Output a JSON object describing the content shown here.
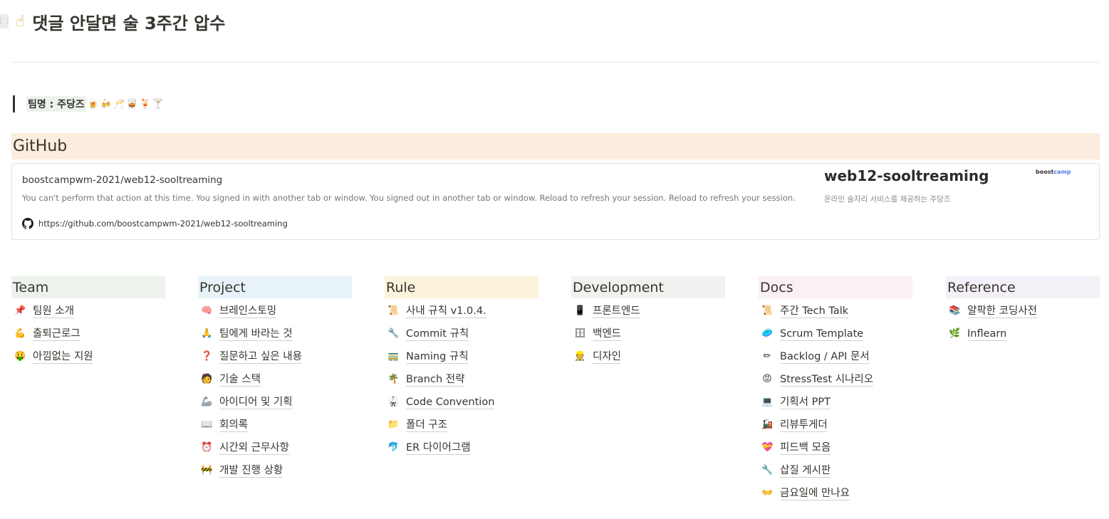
{
  "page": {
    "title_emoji": "☝",
    "title": "댓글 안달면 술 3주간 압수"
  },
  "quote": {
    "text": "팀명 : 주당즈",
    "emojis": "🍺🍻🥂🥃🍹🍸"
  },
  "github_section": {
    "heading": "GitHub",
    "bookmark": {
      "title": "boostcampwm-2021/web12-sooltreaming",
      "description": "You can't perform that action at this time. You signed in with another tab or window. You signed out in another tab or window. Reload to refresh your session. Reload to refresh your session.",
      "url": "https://github.com/boostcampwm-2021/web12-sooltreaming",
      "preview_title": "web12-sooltreaming",
      "preview_subtitle": "온라인 술자리 서비스를 제공하는 주당즈",
      "preview_logo_a": "boost",
      "preview_logo_b": "camp"
    }
  },
  "colors": {
    "team": "#edf3ec",
    "project": "#e7f3f8",
    "rule": "#fbf3db",
    "development": "#f1f1ef",
    "docs": "#fbf0f4",
    "reference": "#f4f0f7",
    "github_heading": "#fbecdd"
  },
  "columns": [
    {
      "header": "Team",
      "items": [
        {
          "icon": "📌",
          "icon_name": "pushpin-icon",
          "label": "팀원 소개"
        },
        {
          "icon": "💪",
          "icon_name": "flexed-biceps-icon",
          "label": "출퇴근로그"
        },
        {
          "icon": "🤑",
          "icon_name": "money-face-icon",
          "label": "아낌없는 지원"
        }
      ]
    },
    {
      "header": "Project",
      "items": [
        {
          "icon": "🧠",
          "icon_name": "brain-icon",
          "label": "브레인스토밍"
        },
        {
          "icon": "🙏",
          "icon_name": "folded-hands-icon",
          "label": "팀에게 바라는 것"
        },
        {
          "icon": "❓",
          "icon_name": "question-mark-icon",
          "label": "질문하고 싶은 내용"
        },
        {
          "icon": "🧑",
          "icon_name": "technologist-icon",
          "label": "기술 스택"
        },
        {
          "icon": "🦾",
          "icon_name": "mechanical-arm-icon",
          "label": "아이디어 및 기획"
        },
        {
          "icon": "📖",
          "icon_name": "open-book-icon",
          "label": "회의록"
        },
        {
          "icon": "⏰",
          "icon_name": "alarm-clock-icon",
          "label": "시간외 근무사항"
        },
        {
          "icon": "🚧",
          "icon_name": "construction-icon",
          "label": "개발 진행 상황"
        }
      ]
    },
    {
      "header": "Rule",
      "items": [
        {
          "icon": "📜",
          "icon_name": "scroll-icon",
          "label": "사내 규칙 v1.0.4."
        },
        {
          "icon": "🔧",
          "icon_name": "wrench-icon",
          "label": "Commit 규칙"
        },
        {
          "icon": "🚃",
          "icon_name": "railway-car-icon",
          "label": "Naming 규칙"
        },
        {
          "icon": "🌴",
          "icon_name": "palm-tree-icon",
          "label": "Branch 전략"
        },
        {
          "icon": "🥋",
          "icon_name": "martial-arts-uniform-icon",
          "label": "Code Convention"
        },
        {
          "icon": "📁",
          "icon_name": "folder-icon",
          "label": "폴더 구조"
        },
        {
          "icon": "🐬",
          "icon_name": "dolphin-icon",
          "label": "ER 다이어그램"
        }
      ]
    },
    {
      "header": "Development",
      "items": [
        {
          "icon": "📱",
          "icon_name": "mobile-phone-icon",
          "label": "프론트엔드"
        },
        {
          "icon": "🗄",
          "icon_name": "file-cabinet-icon",
          "label": "백엔드"
        },
        {
          "icon": "👷",
          "icon_name": "construction-worker-icon",
          "label": "디자인"
        }
      ]
    },
    {
      "header": "Docs",
      "items": [
        {
          "icon": "📜",
          "icon_name": "scroll-icon",
          "label": "주간 Tech Talk"
        },
        {
          "icon": "🥏",
          "icon_name": "flying-disc-icon",
          "label": "Scrum Template"
        },
        {
          "icon": "✏",
          "icon_name": "pencil-icon",
          "label": "Backlog / API 문서"
        },
        {
          "icon": "😡",
          "icon_name": "angry-face-icon",
          "label": "StressTest 시나리오"
        },
        {
          "icon": "💻",
          "icon_name": "laptop-icon",
          "label": "기획서 PPT"
        },
        {
          "icon": "🚂",
          "icon_name": "locomotive-icon",
          "label": "리뷰투게더"
        },
        {
          "icon": "💝",
          "icon_name": "heart-with-ribbon-icon",
          "label": "피드백 모음"
        },
        {
          "icon": "🔧",
          "icon_name": "wrench-icon",
          "label": "삽질 게시판"
        },
        {
          "icon": "👐",
          "icon_name": "open-hands-icon",
          "label": "금요일에 만나요"
        }
      ]
    },
    {
      "header": "Reference",
      "items": [
        {
          "icon": "📚",
          "icon_name": "books-icon",
          "label": "얄팍한 코딩사전"
        },
        {
          "icon": "🌿",
          "icon_name": "herb-icon",
          "label": "Inflearn"
        }
      ]
    }
  ]
}
